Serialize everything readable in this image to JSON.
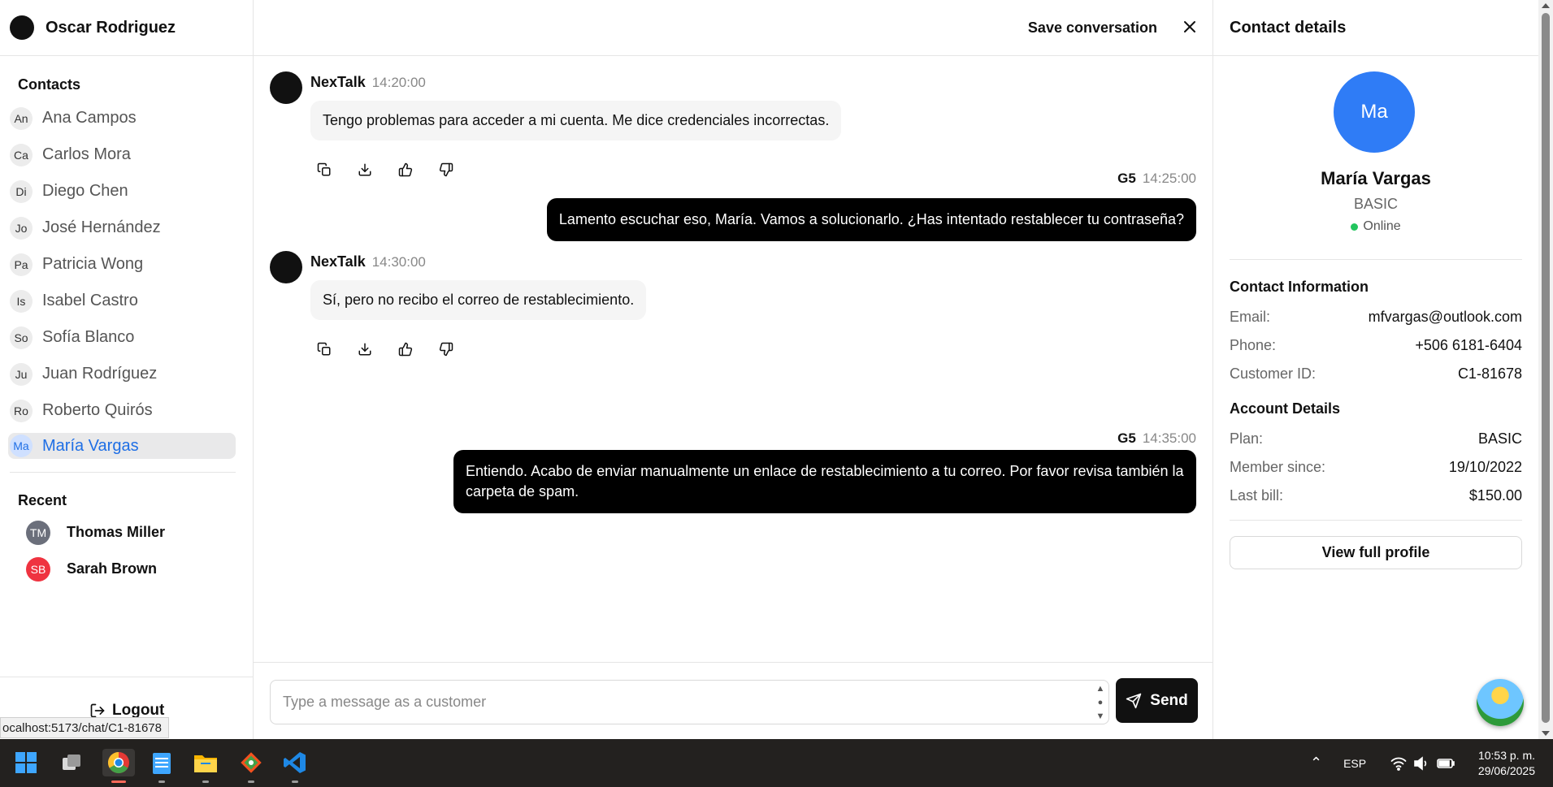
{
  "user": {
    "name": "Oscar Rodriguez"
  },
  "sidebar": {
    "contacts_title": "Contacts",
    "contacts": [
      {
        "initials": "An",
        "name": "Ana Campos"
      },
      {
        "initials": "Ca",
        "name": "Carlos Mora"
      },
      {
        "initials": "Di",
        "name": "Diego Chen"
      },
      {
        "initials": "Jo",
        "name": "José Hernández"
      },
      {
        "initials": "Pa",
        "name": "Patricia Wong"
      },
      {
        "initials": "Is",
        "name": "Isabel Castro"
      },
      {
        "initials": "So",
        "name": "Sofía Blanco"
      },
      {
        "initials": "Ju",
        "name": "Juan Rodríguez"
      },
      {
        "initials": "Ro",
        "name": "Roberto Quirós"
      },
      {
        "initials": "Ma",
        "name": "María Vargas",
        "active": true
      }
    ],
    "recent_title": "Recent",
    "recent": [
      {
        "initials": "TM",
        "name": "Thomas Miller",
        "color": "#6b6f7b"
      },
      {
        "initials": "SB",
        "name": "Sarah Brown",
        "color": "#ef3340"
      }
    ],
    "logout_label": "Logout",
    "url_tooltip": "ocalhost:5173/chat/C1-81678"
  },
  "chat": {
    "save_label": "Save conversation",
    "messages": [
      {
        "sender": "NexTalk",
        "time": "14:20:00",
        "text": "Tengo problemas para acceder a mi cuenta. Me dice credenciales incorrectas.",
        "direction": "in"
      },
      {
        "sender": "G5",
        "time": "14:25:00",
        "text": "Lamento escuchar eso, María. Vamos a solucionarlo. ¿Has intentado restablecer tu contraseña?",
        "direction": "out"
      },
      {
        "sender": "NexTalk",
        "time": "14:30:00",
        "text": "Sí, pero no recibo el correo de restablecimiento.",
        "direction": "in"
      },
      {
        "sender": "G5",
        "time": "14:35:00",
        "text": "Entiendo. Acabo de enviar manualmente un enlace de restablecimiento a tu correo. Por favor revisa también la carpeta de spam.",
        "direction": "out"
      }
    ],
    "input_placeholder": "Type a message as a customer",
    "send_label": "Send"
  },
  "details": {
    "title": "Contact details",
    "initials": "Ma",
    "name": "María Vargas",
    "plan_badge": "BASIC",
    "status": "Online",
    "contact_info_title": "Contact Information",
    "email_label": "Email:",
    "email": "mfvargas@outlook.com",
    "phone_label": "Phone:",
    "phone": "+506 6181-6404",
    "customer_id_label": "Customer ID:",
    "customer_id": "C1-81678",
    "account_title": "Account Details",
    "plan_label": "Plan:",
    "plan": "BASIC",
    "member_label": "Member since:",
    "member_since": "19/10/2022",
    "bill_label": "Last bill:",
    "last_bill": "$150.00",
    "view_profile_label": "View full profile"
  },
  "taskbar": {
    "lang": "ESP",
    "time": "10:53 p. m.",
    "date": "29/06/2025"
  },
  "colors": {
    "accent": "#2f7cf6",
    "active_text": "#1f6fe5",
    "online": "#22c55e",
    "dark": "#111111"
  }
}
